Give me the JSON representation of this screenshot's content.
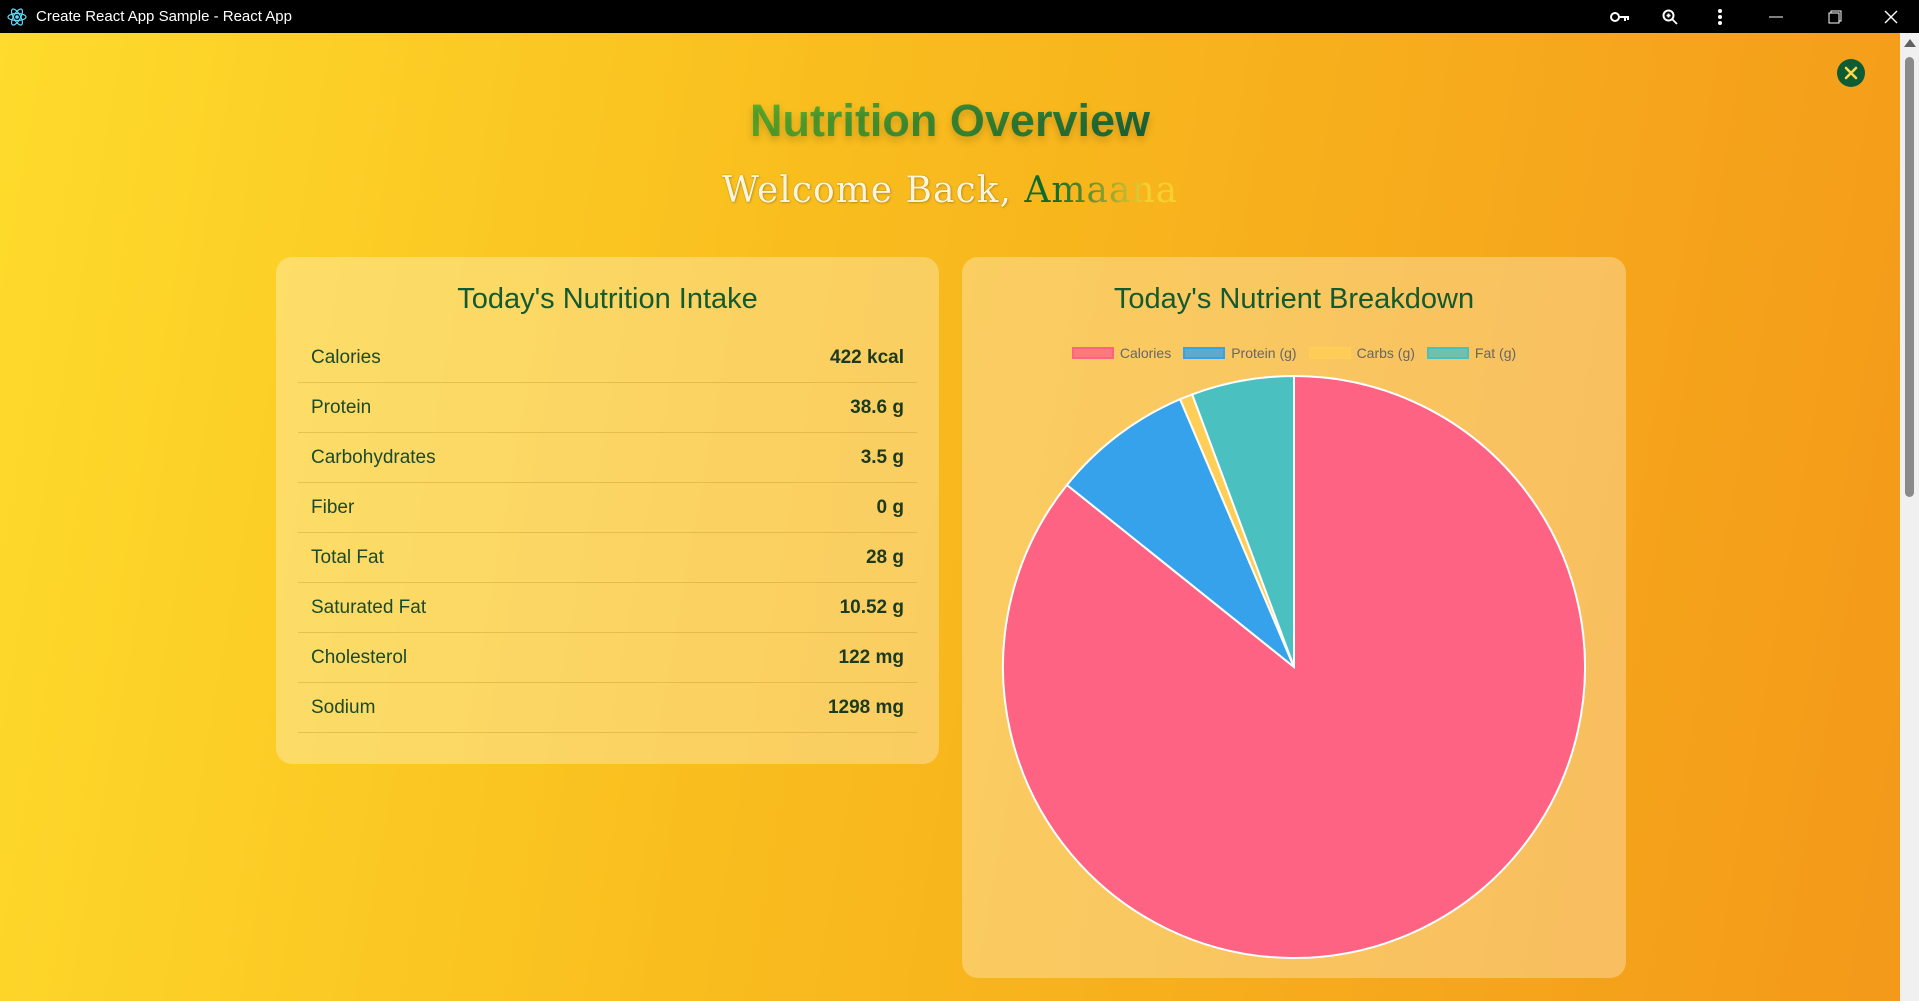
{
  "window": {
    "title": "Create React App Sample - React App"
  },
  "page": {
    "heading": "Nutrition Overview",
    "welcome": "Welcome Back,",
    "user_name": "Amaana"
  },
  "intake": {
    "title": "Today's Nutrition Intake",
    "rows": [
      {
        "name": "Calories",
        "value": "422 kcal"
      },
      {
        "name": "Protein",
        "value": "38.6 g"
      },
      {
        "name": "Carbohydrates",
        "value": "3.5 g"
      },
      {
        "name": "Fiber",
        "value": "0 g"
      },
      {
        "name": "Total Fat",
        "value": "28 g"
      },
      {
        "name": "Saturated Fat",
        "value": "10.52 g"
      },
      {
        "name": "Cholesterol",
        "value": "122 mg"
      },
      {
        "name": "Sodium",
        "value": "1298 mg"
      }
    ]
  },
  "breakdown": {
    "title": "Today's Nutrient Breakdown"
  },
  "icons": [
    "react-icon",
    "key-icon",
    "zoom-icon",
    "more-icon",
    "minimize-icon",
    "restore-icon",
    "close-icon",
    "close-circle-icon"
  ],
  "colors": {
    "accent": "#145a2c",
    "bg_start": "#fedb2c",
    "bg_end": "#f4991a"
  },
  "chart_data": {
    "type": "pie",
    "categories": [
      "Calories",
      "Protein (g)",
      "Carbs (g)",
      "Fat (g)"
    ],
    "values": [
      422,
      38.6,
      3.5,
      28
    ],
    "colors": [
      "#ff6384",
      "#36a2eb",
      "#ffce56",
      "#4bc0c0"
    ],
    "legend": "top"
  }
}
